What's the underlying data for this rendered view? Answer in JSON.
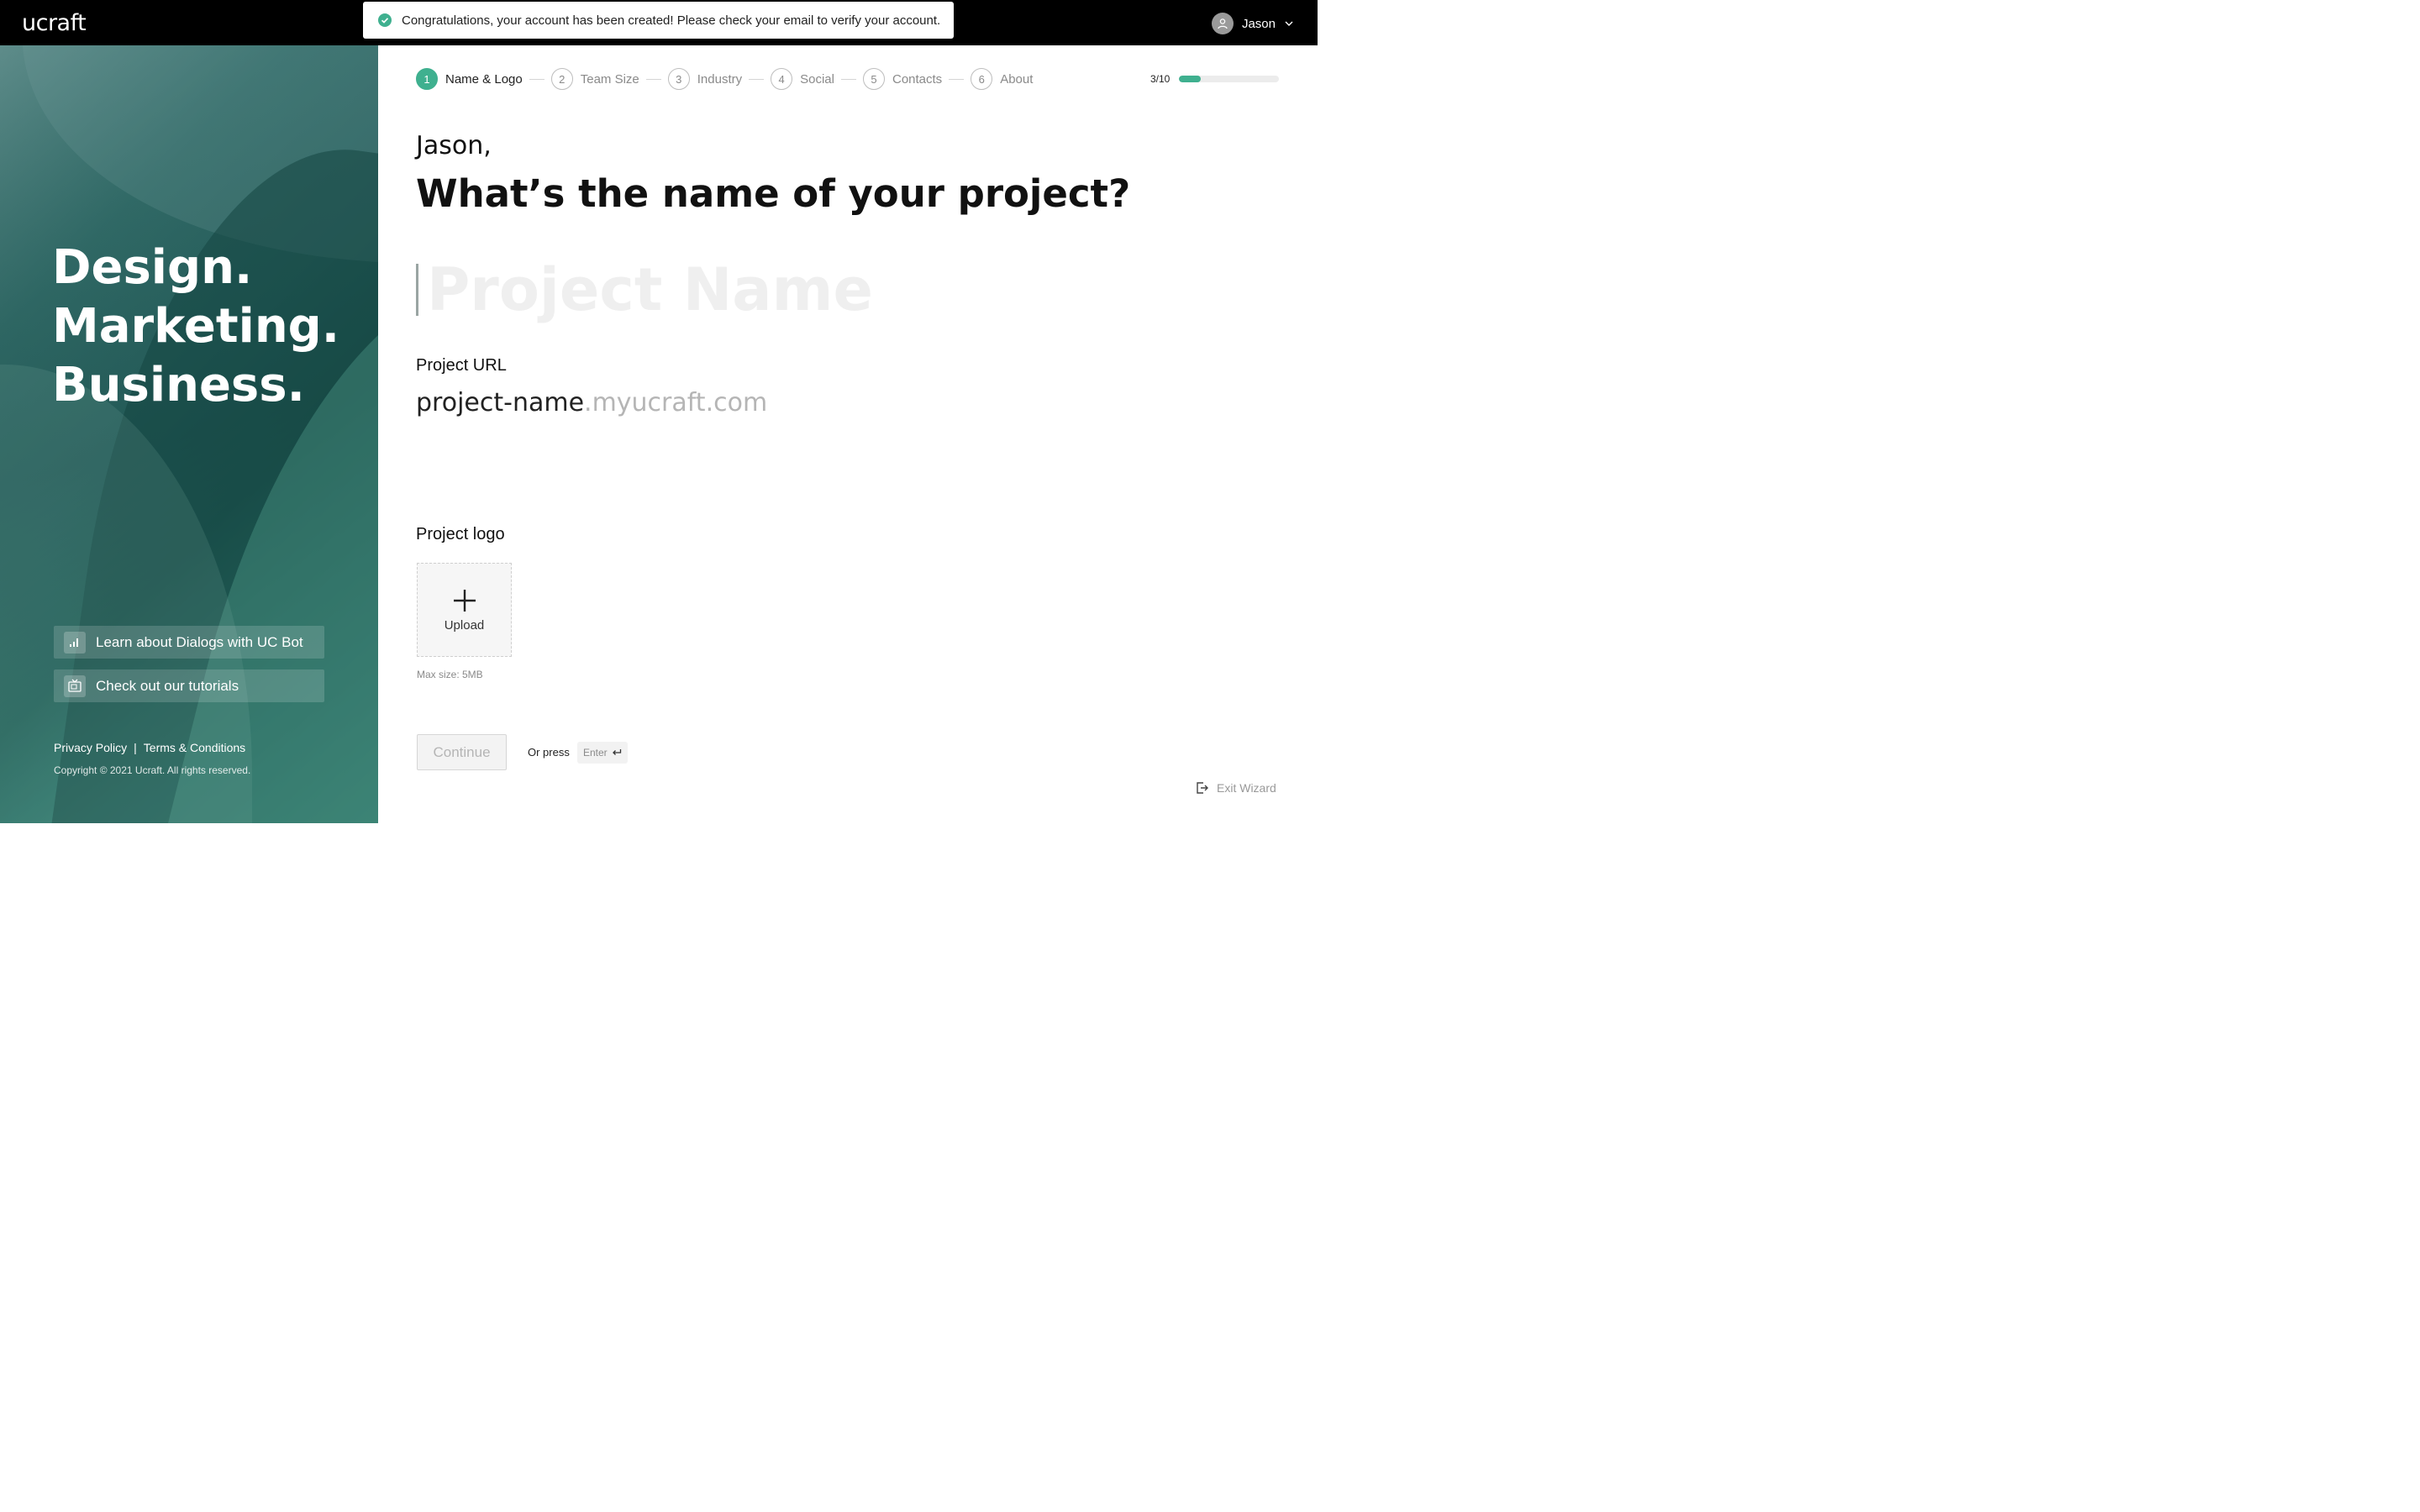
{
  "header": {
    "logo_text": "ucraft",
    "user_name": "Jason"
  },
  "toast": {
    "message": "Congratulations, your account has been created! Please check your email to verify your account.",
    "status_color": "#3fb08f"
  },
  "left_panel": {
    "tagline": [
      "Design.",
      "Marketing.",
      "Business."
    ],
    "links": [
      {
        "label": "Learn about Dialogs with UC Bot",
        "icon": "bot-icon"
      },
      {
        "label": "Check out our tutorials",
        "icon": "tv-icon"
      }
    ],
    "footer": {
      "privacy": "Privacy Policy",
      "separator": "|",
      "terms": "Terms & Conditions",
      "copyright": "Copyright © 2021 Ucraft. All rights reserved."
    }
  },
  "wizard": {
    "steps": [
      {
        "num": "1",
        "label": "Name & Logo",
        "active": true
      },
      {
        "num": "2",
        "label": "Team Size",
        "active": false
      },
      {
        "num": "3",
        "label": "Industry",
        "active": false
      },
      {
        "num": "4",
        "label": "Social",
        "active": false
      },
      {
        "num": "5",
        "label": "Contacts",
        "active": false
      },
      {
        "num": "6",
        "label": "About",
        "active": false
      }
    ],
    "progress_text": "3/10",
    "progress_fraction": 0.22,
    "accent_color": "#3fb08f"
  },
  "main": {
    "greeting": "Jason,",
    "question": "What’s the name of your project?",
    "name_placeholder": "Project Name",
    "url_label": "Project URL",
    "url_slug": "project-name",
    "url_domain": ".myucraft.com",
    "logo_label": "Project logo",
    "upload_label": "Upload",
    "max_size": "Max size: 5MB",
    "continue_label": "Continue",
    "or_press": "Or press",
    "enter_key": "Enter",
    "exit_label": "Exit Wizard"
  }
}
